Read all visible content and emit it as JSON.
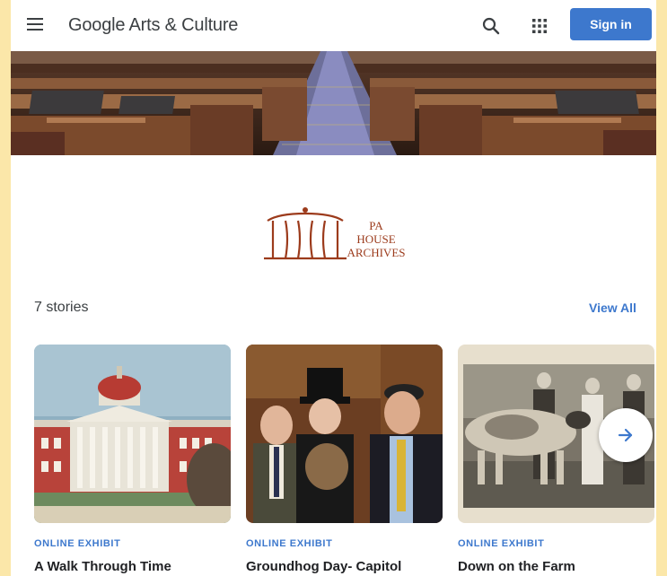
{
  "header": {
    "brand": "Google Arts & Culture",
    "sign_in_label": "Sign in",
    "icons": [
      "menu-icon",
      "search-icon",
      "apps-grid-icon"
    ]
  },
  "partner": {
    "logo_text": [
      "PA",
      "HOUSE",
      "ARCHIVES"
    ]
  },
  "stories": {
    "count_label": "7 stories",
    "view_all_label": "View All",
    "cards": [
      {
        "kind": "ONLINE EXHIBIT",
        "title": "A Walk Through Time"
      },
      {
        "kind": "ONLINE EXHIBIT",
        "title": "Groundhog Day- Capitol"
      },
      {
        "kind": "ONLINE EXHIBIT",
        "title": "Down on the Farm"
      }
    ]
  },
  "colors": {
    "accent": "#3d78cd",
    "page_background": "#fbe7a9",
    "logo_brown": "#9c3b1c"
  }
}
